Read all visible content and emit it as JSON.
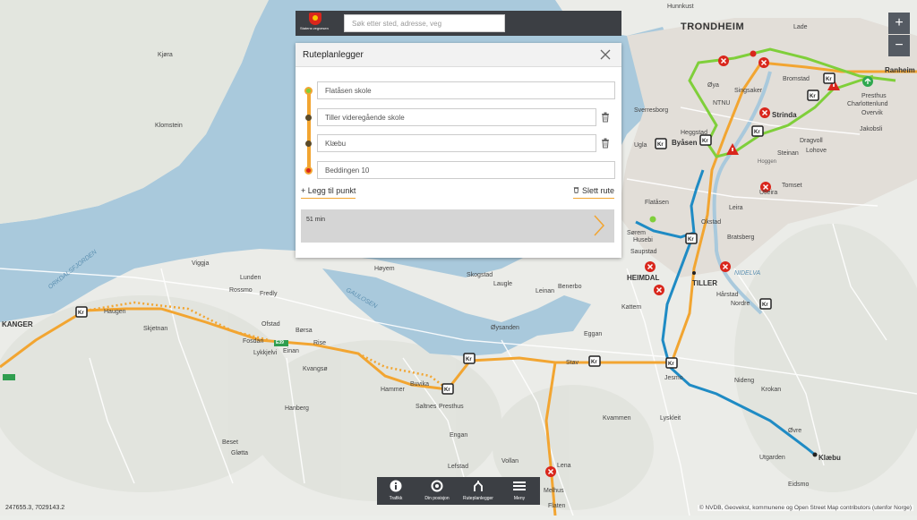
{
  "header": {
    "logo_text": "Statens vegvesen",
    "search_placeholder": "Søk etter sted, adresse, veg"
  },
  "route_panel": {
    "title": "Ruteplanlegger",
    "stops": [
      {
        "value": "Flatåsen skole",
        "type": "start"
      },
      {
        "value": "Tiller videregående skole",
        "type": "via"
      },
      {
        "value": "Klæbu",
        "type": "via"
      },
      {
        "value": "Beddingen 10",
        "type": "end"
      }
    ],
    "add_stop_label": "Legg til punkt",
    "clear_route_label": "Slett rute",
    "result": {
      "duration": "51 min"
    }
  },
  "zoom": {
    "in": "+",
    "out": "−"
  },
  "toolbar": {
    "items": [
      {
        "label": "Trafikk",
        "icon": "info-icon"
      },
      {
        "label": "Din posisjon",
        "icon": "location-icon"
      },
      {
        "label": "Ruteplanlegger",
        "icon": "route-icon"
      },
      {
        "label": "Meny",
        "icon": "menu-icon"
      }
    ]
  },
  "map": {
    "coordinates": "247655.3, 7029143.2",
    "attribution": "© NVDB, Geovekst, kommunene og Open Street Map contributors (utenfor Norge)",
    "places": {
      "trondheim": "TRONDHEIM",
      "heimdal": "HEIMDAL",
      "tiller": "TILLER",
      "klaebu": "Klæbu",
      "kanger": "KANGER",
      "byasen": "Byåsen",
      "strinda": "Strinda",
      "lade": "Lade",
      "ranheim": "Ranheim",
      "viggja": "Viggja",
      "borsa": "Børsa",
      "buvika": "Buvika",
      "melhus": "Melhus",
      "hunnkust": "Hunnkust",
      "kjora": "Kjøra",
      "klomstein": "Klomstein",
      "haugen": "Haugen",
      "skjetnan": "Skjetnan",
      "lunden": "Lunden",
      "rossmo": "Rossmo",
      "fredly": "Fredly",
      "ofstad": "Ofstad",
      "fosdan": "Fosdan",
      "lykkjelvi": "Lykkjelvi",
      "einan": "Einan",
      "rise": "Rise",
      "kvangso": "Kvangsø",
      "hammer": "Hammer",
      "saltnes": "Saltnes",
      "presthus": "Presthus",
      "skogstad": "Skogstad",
      "hoyem": "Høyem",
      "laugle": "Laugle",
      "leinan": "Leinan",
      "bengerbo": "Benerbo",
      "oysanden": "Øysanden",
      "kattem": "Kattem",
      "eggan": "Eggan",
      "stav": "Stav",
      "jesmo": "Jesmo",
      "nideng": "Nideng",
      "krokan": "Krokan",
      "lyskleit": "Lyskleit",
      "kvammen": "Kvammen",
      "utleira": "Utleira",
      "tomset": "Tomset",
      "flatasen": "Flatåsen",
      "saupstad": "Saupstad",
      "okstad": "Okstad",
      "leira": "Leira",
      "sorem": "Sørem",
      "husebi": "Husebi",
      "nidelva": "NIDELVA",
      "hostad": "Hårstad",
      "nordre": "Nordre",
      "gaulosen": "GAULOSEN",
      "orkdalsfjorden": "ORKDALSFJORDEN",
      "ugla": "Ugla",
      "sverresborg": "Sverresborg",
      "ntnu": "NTNU",
      "singsaker": "Singsaker",
      "oya": "Øya",
      "bromstad": "Bromstad",
      "charlottenlund": "Charlottenlund",
      "presthus2": "Presthus",
      "jakobsli": "Jakobsli",
      "overvik": "Overvik",
      "dragvoll": "Dragvoll",
      "lohove": "Lohove",
      "steinan": "Steinan",
      "hoggen": "Hoggen",
      "heggstad": "Heggstad",
      "bratsberg": "Bratsberg",
      "lena": "Lena",
      "flaten": "Flaten",
      "vollan": "Vollan",
      "lefstad": "Lefstad",
      "engan": "Engan",
      "hanberg": "Hanberg",
      "beset": "Beset",
      "glotta": "Gløtta",
      "ovre": "Øvre",
      "utgarden": "Utgarden",
      "eidsmo": "Eidsmo",
      "e39": "E39"
    }
  }
}
